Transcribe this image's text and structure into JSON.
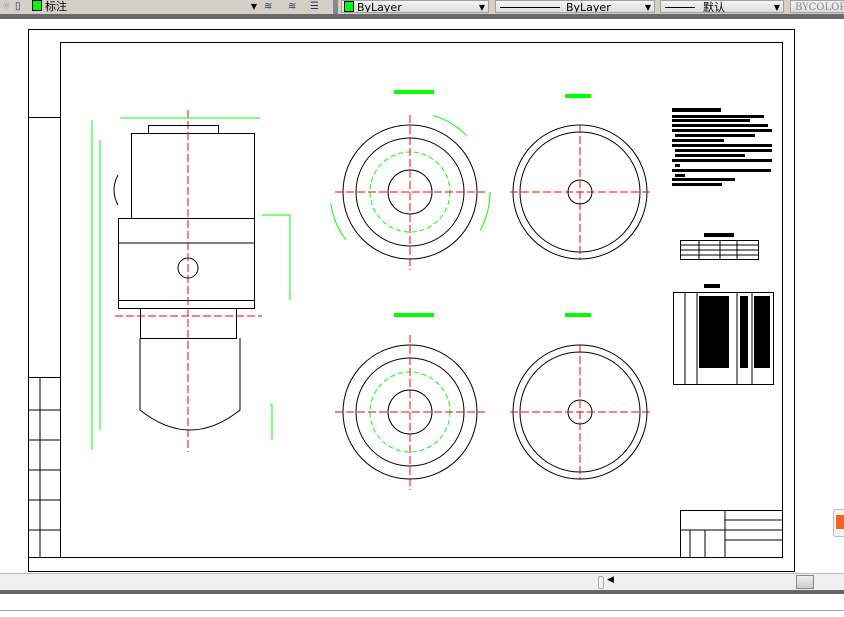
{
  "toolbar": {
    "layer_name": "标注",
    "color": "ByLayer",
    "linetype": "ByLayer",
    "lineweight": "默认",
    "plotstyle": "BYCOLOR",
    "layer_color": "#00ff00"
  },
  "drawing": {
    "line_color": "#000000",
    "dimension_color": "#00ff00",
    "centerline_color": "#ff0000",
    "background": "#ffffff"
  }
}
